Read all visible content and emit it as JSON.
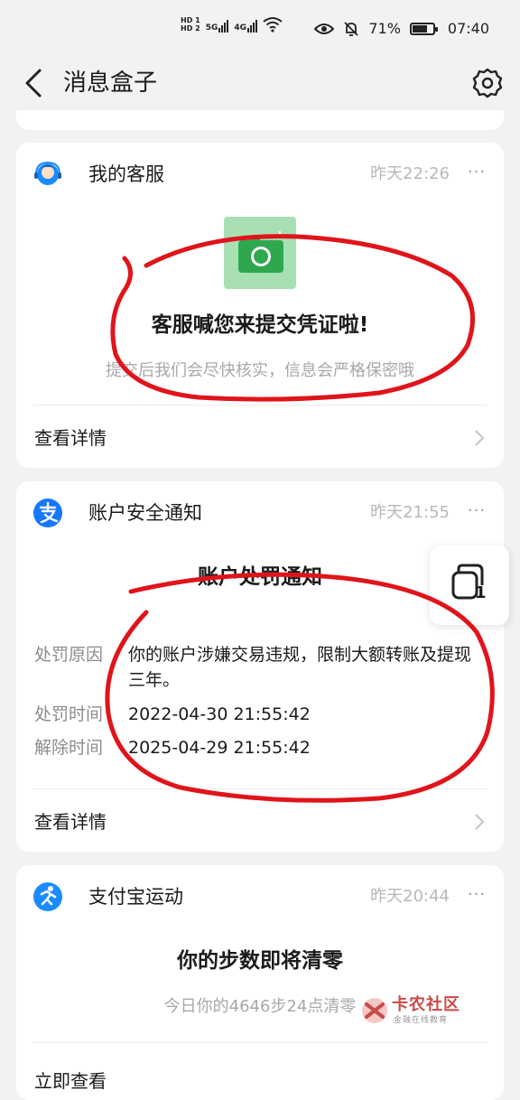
{
  "status_bar": {
    "hd1": "HD 1",
    "hd2": "HD 2",
    "net1": "5G",
    "net2": "4G",
    "battery_percent": "71%",
    "battery_level": 0.71,
    "time": "07:40"
  },
  "header": {
    "title": "消息盒子"
  },
  "cards": [
    {
      "app_name": "我的客服",
      "time": "昨天22:26",
      "more": "···",
      "title": "客服喊您来提交凭证啦!",
      "subtitle": "提交后我们会尽快核实，信息会严格保密哦",
      "action": "查看详情"
    },
    {
      "app_name": "账户安全通知",
      "time": "昨天21:55",
      "more": "···",
      "title": "账户处罚通知",
      "rows": [
        {
          "key": "处罚原因",
          "value": "你的账户涉嫌交易违规，限制大额转账及提现三年。"
        },
        {
          "key": "处罚时间",
          "value": "2022-04-30 21:55:42"
        },
        {
          "key": "解除时间",
          "value": "2025-04-29 21:55:42"
        }
      ],
      "action": "查看详情"
    },
    {
      "app_name": "支付宝运动",
      "time": "昨天20:44",
      "more": "···",
      "title": "你的步数即将清零",
      "subtitle": "今日你的4646步24点清零",
      "action": "立即查看"
    }
  ],
  "float_button": {
    "count": "1"
  },
  "watermark": {
    "title": "卡农社区",
    "subtitle": "金融在线教育"
  },
  "colors": {
    "accent_blue": "#1677ff",
    "annotation_red": "#e0141b",
    "green_tile": "#a8e0b4"
  }
}
